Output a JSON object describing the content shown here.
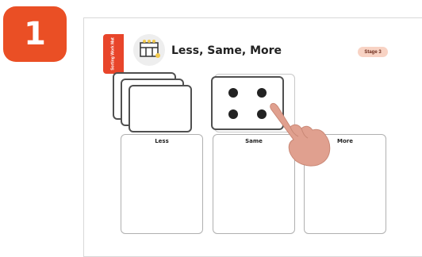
{
  "step": {
    "number": "1"
  },
  "mat": {
    "side_tab": "Sorting Work Mat",
    "title": "Less, Same, More",
    "stage": "Stage 3",
    "bins": [
      {
        "label": "Less"
      },
      {
        "label": "Same"
      },
      {
        "label": "More"
      }
    ],
    "dot_card": {
      "dots": 4
    }
  },
  "colors": {
    "accent": "#ea4f25",
    "tab": "#e8452a",
    "stage_bg": "#f8d3c4",
    "hand": "#e0a08f"
  },
  "icons": {
    "mat_icon": "board-icon",
    "hand": "pointing-hand-icon"
  }
}
